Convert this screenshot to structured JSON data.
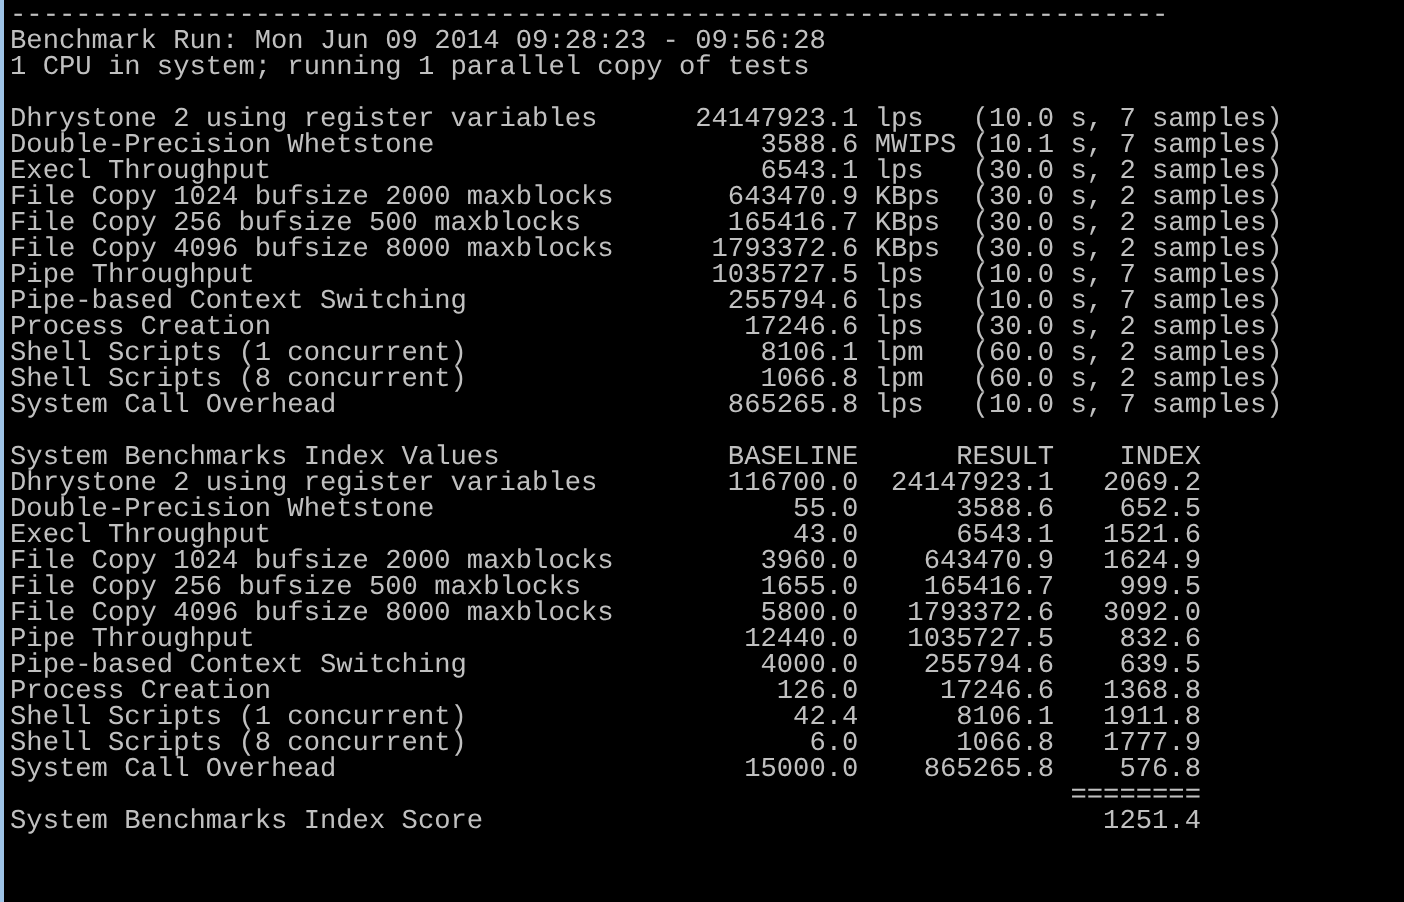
{
  "header": {
    "rule": "-----------------------------------------------------------------------",
    "run": "Benchmark Run: Mon Jun 09 2014 09:28:23 - 09:56:28",
    "system": "1 CPU in system; running 1 parallel copy of tests"
  },
  "results": [
    {
      "name": "Dhrystone 2 using register variables",
      "value": "24147923.1",
      "unit": "lps",
      "details": "(10.0 s, 7 samples)"
    },
    {
      "name": "Double-Precision Whetstone",
      "value": "3588.6",
      "unit": "MWIPS",
      "details": "(10.1 s, 7 samples)"
    },
    {
      "name": "Execl Throughput",
      "value": "6543.1",
      "unit": "lps",
      "details": "(30.0 s, 2 samples)"
    },
    {
      "name": "File Copy 1024 bufsize 2000 maxblocks",
      "value": "643470.9",
      "unit": "KBps",
      "details": "(30.0 s, 2 samples)"
    },
    {
      "name": "File Copy 256 bufsize 500 maxblocks",
      "value": "165416.7",
      "unit": "KBps",
      "details": "(30.0 s, 2 samples)"
    },
    {
      "name": "File Copy 4096 bufsize 8000 maxblocks",
      "value": "1793372.6",
      "unit": "KBps",
      "details": "(30.0 s, 2 samples)"
    },
    {
      "name": "Pipe Throughput",
      "value": "1035727.5",
      "unit": "lps",
      "details": "(10.0 s, 7 samples)"
    },
    {
      "name": "Pipe-based Context Switching",
      "value": "255794.6",
      "unit": "lps",
      "details": "(10.0 s, 7 samples)"
    },
    {
      "name": "Process Creation",
      "value": "17246.6",
      "unit": "lps",
      "details": "(30.0 s, 2 samples)"
    },
    {
      "name": "Shell Scripts (1 concurrent)",
      "value": "8106.1",
      "unit": "lpm",
      "details": "(60.0 s, 2 samples)"
    },
    {
      "name": "Shell Scripts (8 concurrent)",
      "value": "1066.8",
      "unit": "lpm",
      "details": "(60.0 s, 2 samples)"
    },
    {
      "name": "System Call Overhead",
      "value": "865265.8",
      "unit": "lps",
      "details": "(10.0 s, 7 samples)"
    }
  ],
  "index_table": {
    "title": "System Benchmarks Index Values",
    "columns": [
      "BASELINE",
      "RESULT",
      "INDEX"
    ],
    "rows": [
      {
        "name": "Dhrystone 2 using register variables",
        "baseline": "116700.0",
        "result": "24147923.1",
        "index": "2069.2"
      },
      {
        "name": "Double-Precision Whetstone",
        "baseline": "55.0",
        "result": "3588.6",
        "index": "652.5"
      },
      {
        "name": "Execl Throughput",
        "baseline": "43.0",
        "result": "6543.1",
        "index": "1521.6"
      },
      {
        "name": "File Copy 1024 bufsize 2000 maxblocks",
        "baseline": "3960.0",
        "result": "643470.9",
        "index": "1624.9"
      },
      {
        "name": "File Copy 256 bufsize 500 maxblocks",
        "baseline": "1655.0",
        "result": "165416.7",
        "index": "999.5"
      },
      {
        "name": "File Copy 4096 bufsize 8000 maxblocks",
        "baseline": "5800.0",
        "result": "1793372.6",
        "index": "3092.0"
      },
      {
        "name": "Pipe Throughput",
        "baseline": "12440.0",
        "result": "1035727.5",
        "index": "832.6"
      },
      {
        "name": "Pipe-based Context Switching",
        "baseline": "4000.0",
        "result": "255794.6",
        "index": "639.5"
      },
      {
        "name": "Process Creation",
        "baseline": "126.0",
        "result": "17246.6",
        "index": "1368.8"
      },
      {
        "name": "Shell Scripts (1 concurrent)",
        "baseline": "42.4",
        "result": "8106.1",
        "index": "1911.8"
      },
      {
        "name": "Shell Scripts (8 concurrent)",
        "baseline": "6.0",
        "result": "1066.8",
        "index": "1777.9"
      },
      {
        "name": "System Call Overhead",
        "baseline": "15000.0",
        "result": "865265.8",
        "index": "576.8"
      }
    ],
    "total_rule": "========",
    "score_label": "System Benchmarks Index Score",
    "score": "1251.4"
  }
}
